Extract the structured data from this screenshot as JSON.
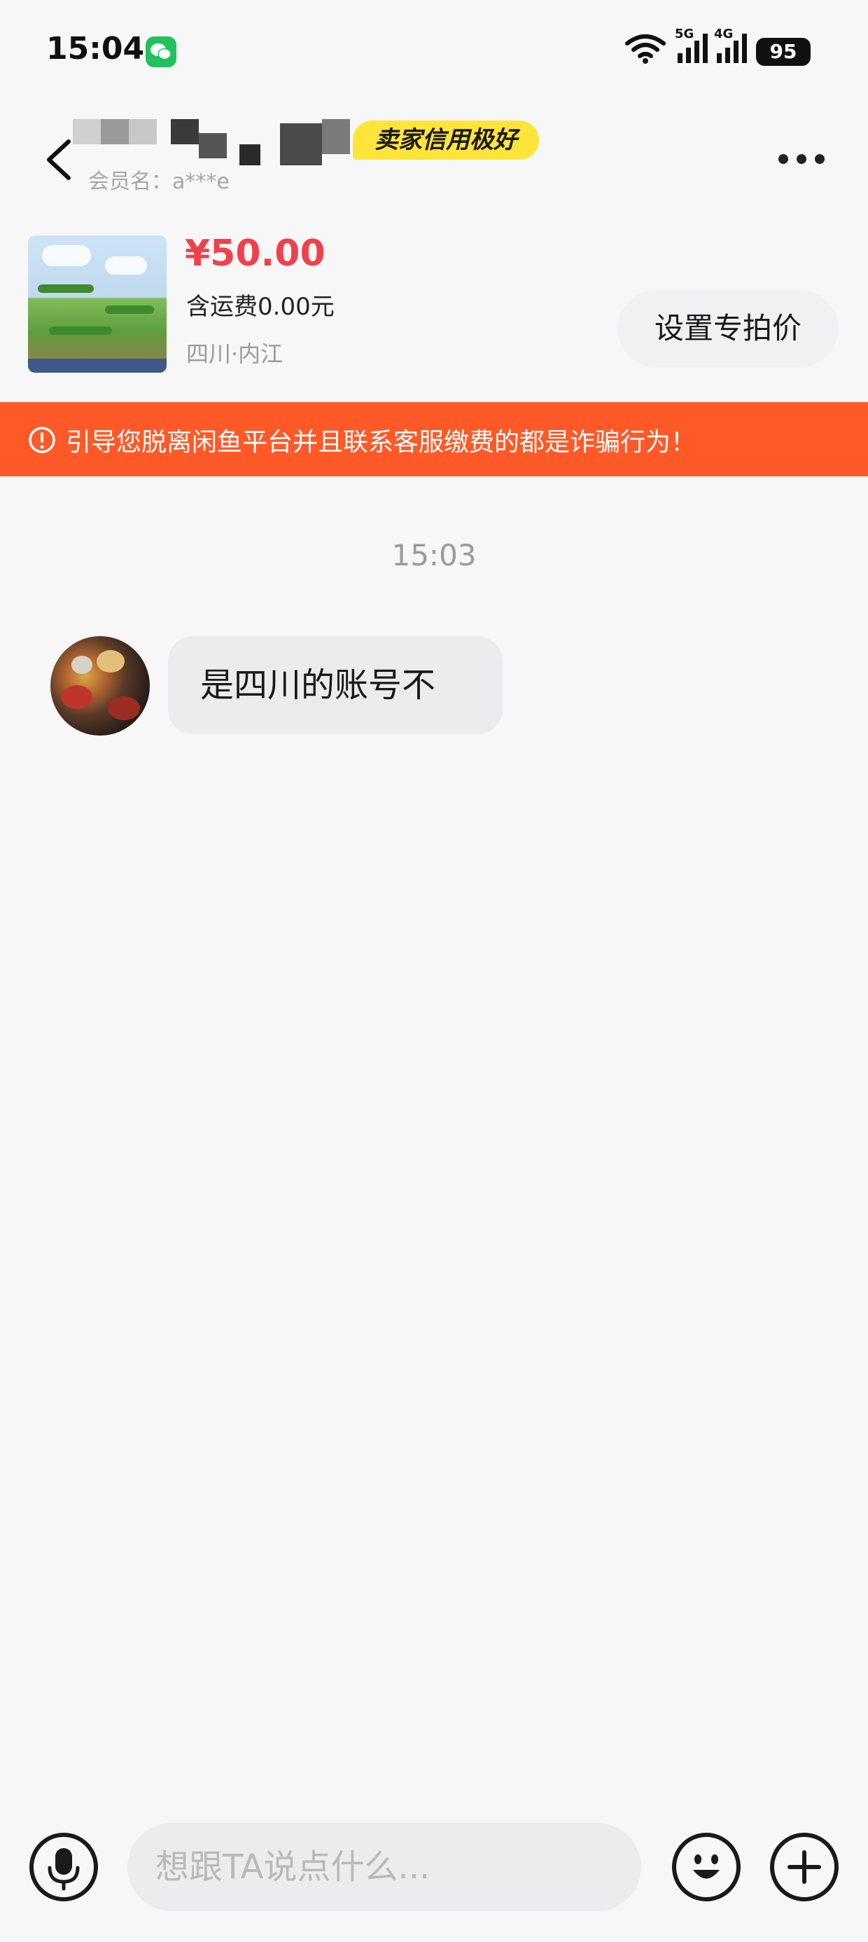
{
  "status_bar": {
    "time": "15:04",
    "signal_1_label": "5G",
    "signal_2_label": "4G",
    "battery": "95"
  },
  "header": {
    "badge": "卖家信用极好",
    "member_name": "会员名：a***e"
  },
  "product": {
    "price": "¥50.00",
    "shipping": "含运费0.00元",
    "location": "四川·内江",
    "set_price_label": "设置专拍价"
  },
  "warning": {
    "text": "引导您脱离闲鱼平台并且联系客服缴费的都是诈骗行为！"
  },
  "chat": {
    "timestamp": "15:03",
    "messages": [
      {
        "text": "是四川的账号不"
      }
    ]
  },
  "input": {
    "placeholder": "想跟TA说点什么..."
  },
  "colors": {
    "price": "#f0414a",
    "warning_banner": "#ff5927",
    "badge": "#ffe43a",
    "wechat": "#21c25e"
  }
}
